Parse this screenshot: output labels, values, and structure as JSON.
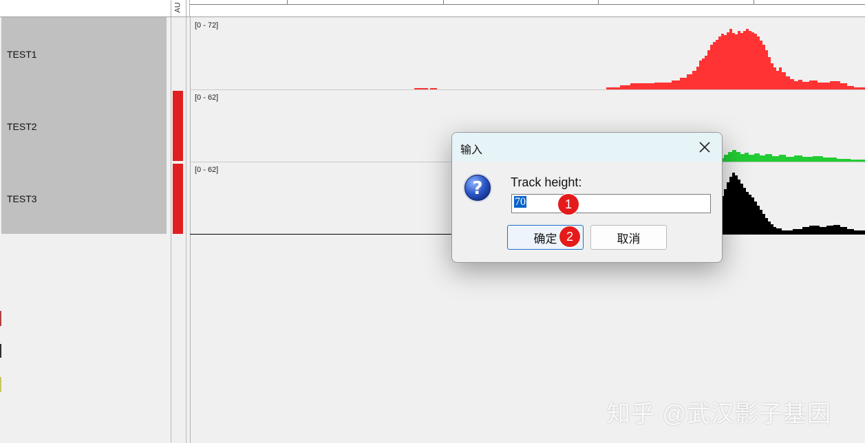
{
  "header": {
    "attribute_column_label": "AU"
  },
  "tracks": [
    {
      "name": "TEST1",
      "range": "[0 - 72]",
      "color": "#ff3333"
    },
    {
      "name": "TEST2",
      "range": "[0 - 62]",
      "color": "#22cc33"
    },
    {
      "name": "TEST3",
      "range": "[0 - 62]",
      "color": "#000000"
    }
  ],
  "dialog": {
    "title": "输入",
    "prompt": "Track height:",
    "value": "70",
    "ok_label": "确定",
    "cancel_label": "取消",
    "icon": "question-icon"
  },
  "annotations": {
    "badge_1": "1",
    "badge_2": "2",
    "color": "#e51b1b"
  },
  "watermark": "知乎 @武汉影子基因"
}
